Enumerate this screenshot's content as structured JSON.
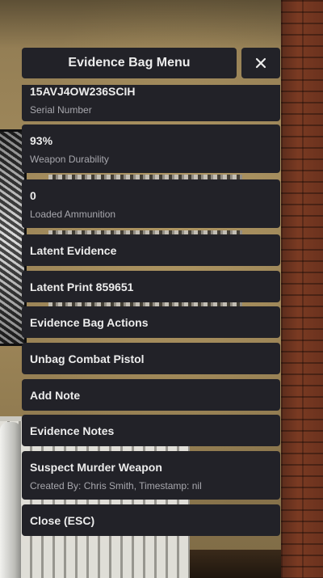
{
  "menu": {
    "title": "Evidence Bag Menu",
    "close_icon": "close-icon",
    "items": [
      {
        "label": "15AVJ4OW236SCIH",
        "sub": "Serial Number"
      },
      {
        "label": "93%",
        "sub": "Weapon Durability"
      },
      {
        "label": "0",
        "sub": "Loaded Ammunition"
      },
      {
        "label": "Latent Evidence"
      },
      {
        "label": "Latent Print 859651"
      },
      {
        "label": "Evidence Bag Actions"
      },
      {
        "label": "Unbag Combat Pistol"
      },
      {
        "label": "Add Note"
      },
      {
        "label": "Evidence Notes"
      },
      {
        "label": "Suspect Murder Weapon",
        "sub": "Created By: Chris Smith, Timestamp: nil"
      },
      {
        "label": "Close (ESC)"
      }
    ]
  },
  "colors": {
    "panel": "#222228",
    "text": "#ececec",
    "subtext": "#a7a7ad"
  }
}
